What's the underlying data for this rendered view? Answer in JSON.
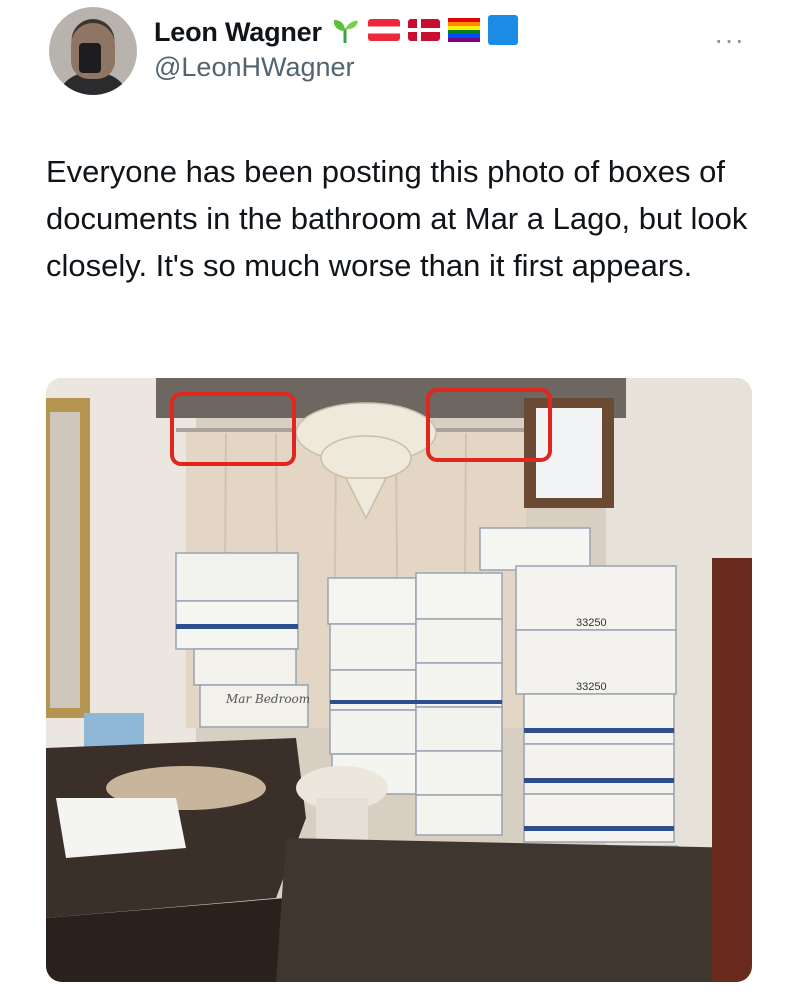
{
  "author": {
    "display_name": "Leon Wagner",
    "handle": "@LeonHWagner",
    "badges": [
      "seedling-emoji",
      "austria-flag-emoji",
      "denmark-flag-emoji",
      "rainbow-flag-emoji",
      "blue-square-emoji"
    ]
  },
  "menu": {
    "more_label": "···"
  },
  "tweet": {
    "text": "Everyone has been posting this photo of boxes of documents in the bathroom at Mar a Lago, but look closely. It's so much worse than it first appears."
  },
  "media": {
    "alt": "Photo of stacked document boxes in a bathroom with a chandelier; shower curtain rod areas circled in red",
    "box_labels": [
      "33250",
      "33250"
    ],
    "handwritten_label": "Mar Bedroom",
    "annotation_color": "#e0261f"
  },
  "colors": {
    "text": "#0f1419",
    "secondary": "#536471"
  }
}
